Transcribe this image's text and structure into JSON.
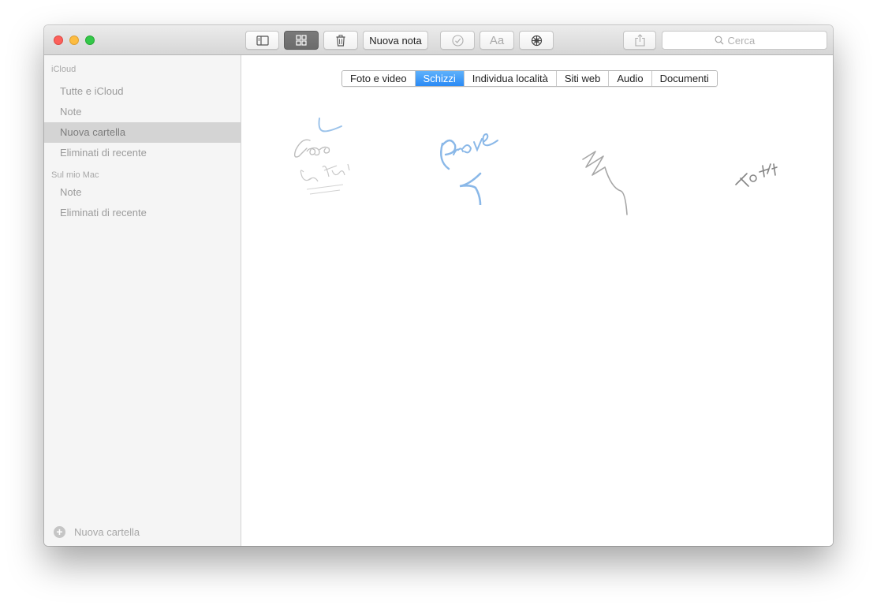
{
  "window": {
    "traffic_lights": [
      "close",
      "minimize",
      "zoom"
    ]
  },
  "toolbar": {
    "sidebar_toggle_icon": "sidebar-icon",
    "gallery_icon": "grid-icon",
    "delete_icon": "trash-icon",
    "new_note_label": "Nuova nota",
    "checklist_icon": "checkmark-circle-icon",
    "format_label": "Aa",
    "attachment_icon": "attachments-icon",
    "share_icon": "share-icon",
    "search_placeholder": "Cerca"
  },
  "sidebar": {
    "sections": [
      {
        "header": "iCloud",
        "items": [
          {
            "label": "Tutte e iCloud",
            "selected": false
          },
          {
            "label": "Note",
            "selected": false
          },
          {
            "label": "Nuova cartella",
            "selected": true
          },
          {
            "label": "Eliminati di recente",
            "selected": false
          }
        ]
      },
      {
        "header": "Sul mio Mac",
        "items": [
          {
            "label": "Note",
            "selected": false
          },
          {
            "label": "Eliminati di recente",
            "selected": false
          }
        ]
      }
    ],
    "new_folder_label": "Nuova cartella"
  },
  "main": {
    "tabs": [
      {
        "label": "Foto e video",
        "selected": false
      },
      {
        "label": "Schizzi",
        "selected": true
      },
      {
        "label": "Individua località",
        "selected": false
      },
      {
        "label": "Siti web",
        "selected": false
      },
      {
        "label": "Audio",
        "selected": false
      },
      {
        "label": "Documenti",
        "selected": false
      }
    ],
    "sketches": [
      {
        "id": "sketch-1",
        "color": "#bdbdbd",
        "accent": "#9cc3ea"
      },
      {
        "id": "sketch-2",
        "color": "#8ab8e8"
      },
      {
        "id": "sketch-3",
        "color": "#a6a6a6"
      },
      {
        "id": "sketch-4",
        "color": "#858585"
      }
    ]
  },
  "colors": {
    "accent": "#2a8af5",
    "sidebar_bg": "#f5f5f5",
    "sidebar_selected": "#d4d4d4"
  }
}
